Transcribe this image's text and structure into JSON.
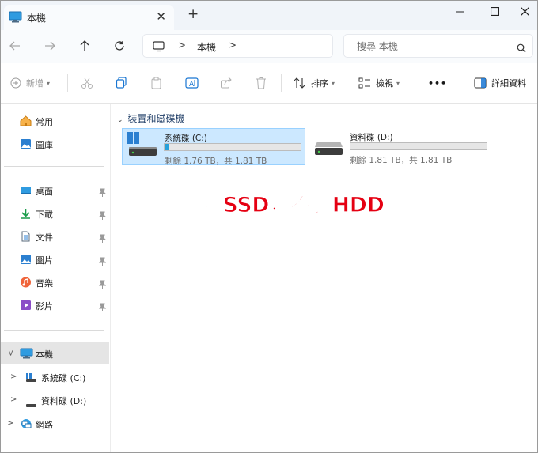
{
  "tab": {
    "title": "本機",
    "close": "✕",
    "new": "+"
  },
  "window_controls": {
    "minimize": "—",
    "maximize": "☐",
    "close": "✕"
  },
  "breadcrumb": {
    "items": [
      "本機"
    ]
  },
  "search": {
    "placeholder": "搜尋 本機"
  },
  "commands": {
    "new": "新增",
    "sort": "排序",
    "view": "檢視",
    "more": "•••",
    "details": "詳細資料"
  },
  "sidebar": {
    "quick": [
      {
        "label": "常用",
        "icon": "home-icon"
      },
      {
        "label": "圖庫",
        "icon": "gallery-icon"
      }
    ],
    "pinned": [
      {
        "label": "桌面",
        "icon": "desktop-folder-icon"
      },
      {
        "label": "下載",
        "icon": "download-icon"
      },
      {
        "label": "文件",
        "icon": "document-icon"
      },
      {
        "label": "圖片",
        "icon": "pictures-icon"
      },
      {
        "label": "音樂",
        "icon": "music-icon"
      },
      {
        "label": "影片",
        "icon": "video-icon"
      }
    ],
    "tree": [
      {
        "label": "本機",
        "icon": "pc-icon",
        "selected": true
      },
      {
        "label": "系統碟 (C:)",
        "icon": "windows-drive-icon"
      },
      {
        "label": "資料碟 (D:)",
        "icon": "drive-icon"
      },
      {
        "label": "網路",
        "icon": "network-icon"
      }
    ]
  },
  "group": {
    "title": "裝置和磁碟機"
  },
  "drives": [
    {
      "name": "系統碟 (C:)",
      "status": "剩餘 1.76 TB，共 1.81 TB",
      "used_fraction": 0.03,
      "selected": true
    },
    {
      "name": "資料碟 (D:)",
      "status": "剩餘 1.81 TB，共 1.81 TB",
      "used_fraction": 0.0,
      "selected": false
    }
  ],
  "annotation": "雙SSD，不裝HDD",
  "colors": {
    "accent": "#26a0da",
    "annotation": "#e50012",
    "selection": "#cce8ff"
  }
}
